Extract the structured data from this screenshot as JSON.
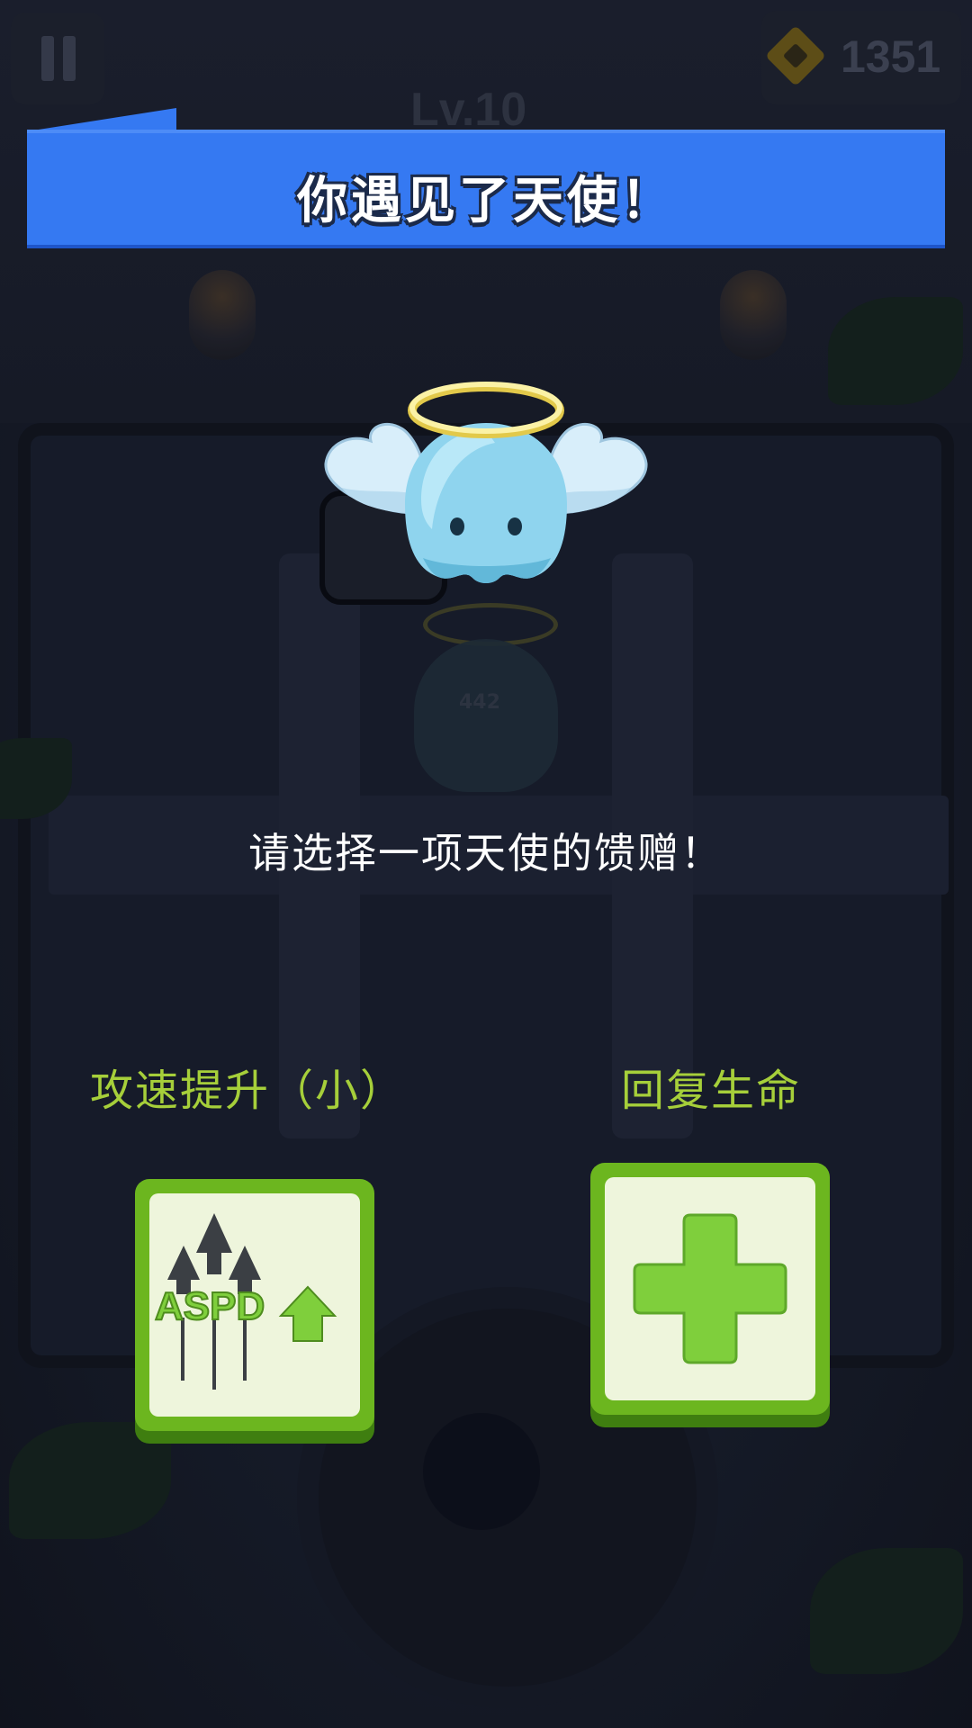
{
  "hud": {
    "pause_icon": "pause-icon",
    "coin_icon": "gem-icon",
    "coin_count": "1351",
    "level": "Lv.10"
  },
  "event": {
    "title": "你遇见了天使！",
    "angel_icon": "winged-angel-ghost-with-halo",
    "prompt": "请选择一项天使的馈赠！"
  },
  "choices": [
    {
      "label": "攻速提升（小）",
      "icon": "aspd-up-icon",
      "icon_text": "ASPD"
    },
    {
      "label": "回复生命",
      "icon": "heal-plus-icon"
    }
  ],
  "background_hint_number": "442",
  "colors": {
    "banner": "#3579f2",
    "choice_label": "#a6cf3a",
    "card_border": "#6cb61f",
    "card_face": "#eef5dc",
    "plus": "#7fcf3c",
    "angel_body": "#8fd4ee",
    "halo": "#f5e98a"
  }
}
